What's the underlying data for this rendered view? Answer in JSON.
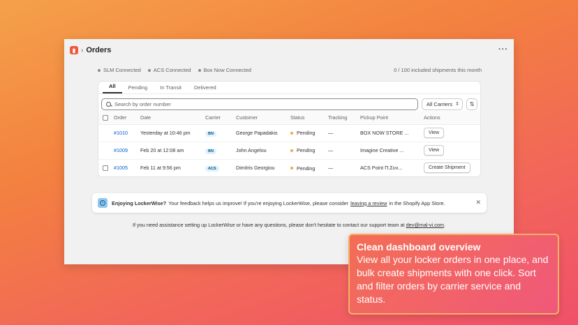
{
  "header": {
    "app_icon": "lockerwise-logo-icon",
    "title": "Orders",
    "more": "···"
  },
  "status": {
    "connections": [
      "SLM Connected",
      "ACS Connected",
      "Box Now Connected"
    ],
    "quota": "0 / 100 included shipments this month"
  },
  "tabs": [
    "All",
    "Pending",
    "In Transit",
    "Delivered"
  ],
  "search": {
    "placeholder": "Search by order number",
    "carrier_filter": "All Carriers"
  },
  "table": {
    "headers": [
      "Order",
      "Date",
      "Carrier",
      "Customer",
      "Status",
      "Tracking",
      "Pickup Point",
      "Actions"
    ],
    "rows": [
      {
        "order": "#1010",
        "date": "Yesterday at 10:46 pm",
        "carrier": "BN",
        "customer": "George Papadakis",
        "status": "Pending",
        "tracking": "—",
        "pickup": "BOX NOW STORE ...",
        "action": "View",
        "checkbox": false
      },
      {
        "order": "#1009",
        "date": "Feb 20 at 12:08 am",
        "carrier": "BN",
        "customer": "John Angelou",
        "status": "Pending",
        "tracking": "—",
        "pickup": "Imagine Creative ...",
        "action": "View",
        "checkbox": false
      },
      {
        "order": "#1005",
        "date": "Feb 11 at 9:56 pm",
        "carrier": "ACS",
        "customer": "Dimitris Georgiou",
        "status": "Pending",
        "tracking": "—",
        "pickup": "ACS Point Π.Συν...",
        "action": "Create Shipment",
        "checkbox": true
      }
    ]
  },
  "banner": {
    "title": "Enjoying LockerWise?",
    "text_before": "Your feedback helps us improve! If you're enjoying LockerWise, please consider",
    "link": "leaving a review",
    "text_after": "in the Shopify App Store."
  },
  "help": {
    "text": "If you need assistance setting up LockerWise or have any questions, please don't hesitate to contact our support team at",
    "email": "dev@mal-vi.com",
    "suffix": "."
  },
  "promo": {
    "title": "Clean dashboard overview",
    "body": "View all your locker orders in one place, and bulk create shipments with one click. Sort and filter orders by carrier service and status."
  },
  "colors": {
    "link": "#005bd3",
    "pending": "#f0a64a",
    "promo_bg": "#f0587a",
    "promo_border": "#f8b068"
  }
}
